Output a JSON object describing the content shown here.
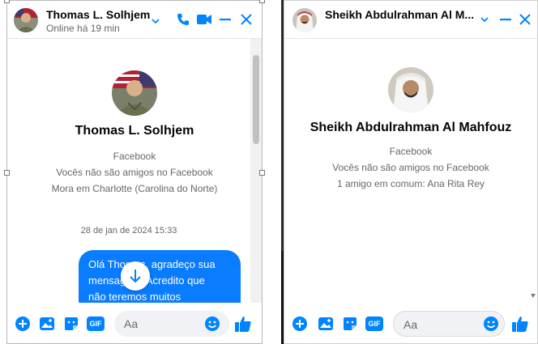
{
  "left_chat": {
    "header": {
      "name": "Thomas L. Solhjem",
      "status": "Online há 19 min"
    },
    "profile": {
      "name": "Thomas L. Solhjem",
      "lines": [
        "Facebook",
        "Vocês não são amigos no Facebook",
        "Mora em Charlotte (Carolina do Norte)"
      ]
    },
    "timestamp": "28 de jan de 2024 15:33",
    "message": {
      "line1": "Olá Thomas, agradeço sua",
      "line2": "mensagem. Acredito que",
      "line3": "não teremos muitos"
    },
    "composer": {
      "placeholder": "Aa"
    }
  },
  "right_chat": {
    "header": {
      "name": "Sheikh Abdulrahman Al M..."
    },
    "profile": {
      "name": "Sheikh Abdulrahman Al Mahfouz",
      "lines": [
        "Facebook",
        "Vocês não são amigos no Facebook",
        "1 amigo em comum: Ana Rita Rey"
      ]
    },
    "composer": {
      "placeholder": "Aa"
    }
  },
  "icons": {
    "phone": "phone-icon",
    "video": "video-icon",
    "minimize": "minimize-icon",
    "close": "close-icon",
    "chevron": "chevron-down-icon",
    "plus": "plus-circle-icon",
    "image": "image-icon",
    "sticker": "sticker-icon",
    "gif": "gif-icon",
    "emoji": "emoji-icon",
    "like": "thumbs-up-icon"
  },
  "colors": {
    "accent": "#0084ff",
    "bubble": "#0a7cff",
    "muted": "#65676b"
  },
  "gif_label": "GIF"
}
